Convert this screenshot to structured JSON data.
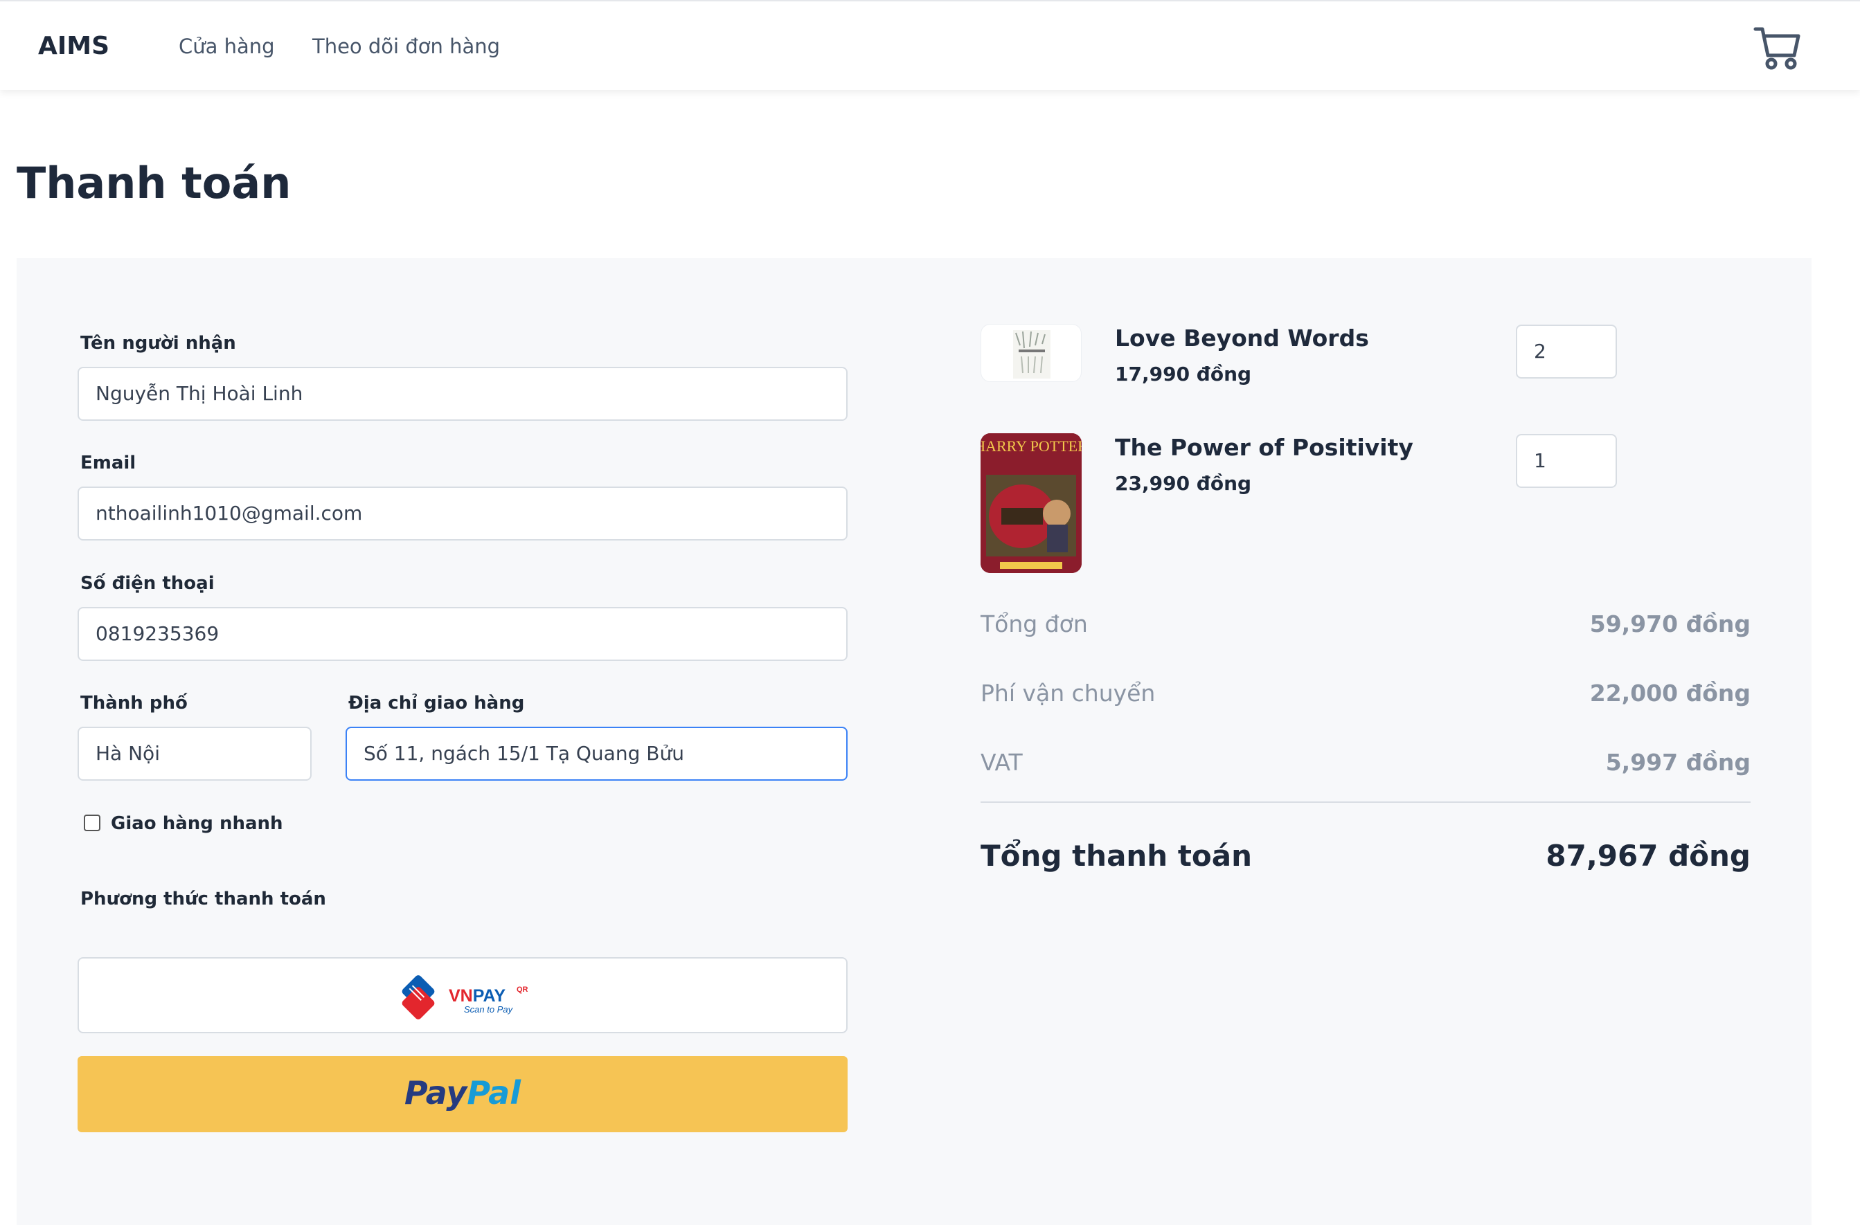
{
  "header": {
    "logo": "AIMS",
    "nav": [
      {
        "label": "Cửa hàng"
      },
      {
        "label": "Theo dõi đơn hàng"
      }
    ],
    "cart_icon": "cart-icon"
  },
  "page": {
    "title": "Thanh toán"
  },
  "form": {
    "name": {
      "label": "Tên người nhận",
      "value": "Nguyễn Thị Hoài Linh"
    },
    "email": {
      "label": "Email",
      "value": "nthoailinh1010@gmail.com"
    },
    "phone": {
      "label": "Số điện thoại",
      "value": "0819235369"
    },
    "city": {
      "label": "Thành phố",
      "value": "Hà Nội"
    },
    "address": {
      "label": "Địa chỉ giao hàng",
      "value": "Số 11, ngách 15/1 Tạ Quang Bửu"
    },
    "express": {
      "label": "Giao hàng nhanh",
      "checked": false
    },
    "payment": {
      "label": "Phương thức thanh toán",
      "vnpay": {
        "brand": "VNPAY",
        "superscript": "QR",
        "tagline": "Scan to Pay"
      },
      "paypal": {
        "part1": "Pay",
        "part2": "Pal"
      }
    }
  },
  "cart": {
    "items": [
      {
        "title": "Love Beyond Words",
        "price": "17,990 đồng",
        "qty": "2"
      },
      {
        "title": "The Power of Positivity",
        "price": "23,990 đồng",
        "qty": "1",
        "cover_title": "HARRY POTTER"
      }
    ]
  },
  "summary": {
    "subtotal": {
      "label": "Tổng đơn",
      "value": "59,970 đồng"
    },
    "shipping": {
      "label": "Phí vận chuyển",
      "value": "22,000 đồng"
    },
    "vat": {
      "label": "VAT",
      "value": "5,997 đồng"
    },
    "total": {
      "label": "Tổng thanh toán",
      "value": "87,967 đồng"
    }
  },
  "colors": {
    "paypal_bg": "#f6c454",
    "focus_border": "#3b82f6",
    "panel_bg": "#f7f8fa"
  }
}
